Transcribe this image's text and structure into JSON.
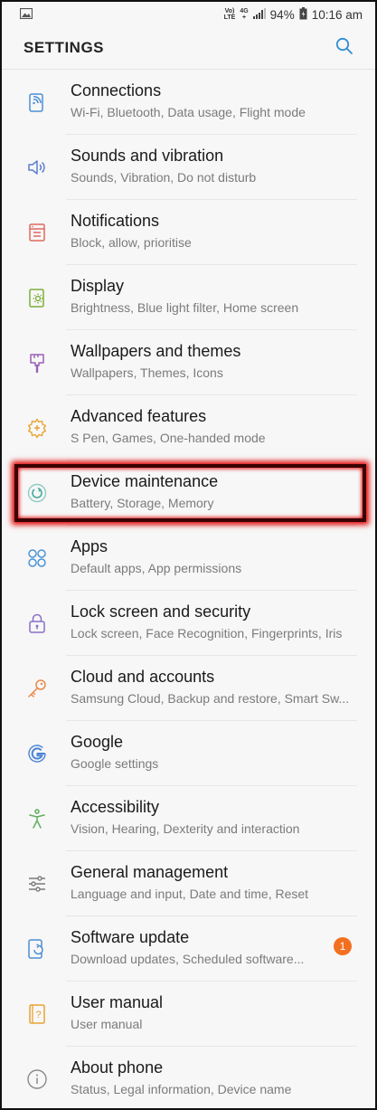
{
  "statusbar": {
    "net_top": "Vo)",
    "net_bottom": "LTE",
    "g_top": "4G",
    "g_bottom": "+",
    "battery": "94%",
    "time": "10:16 am"
  },
  "header": {
    "title": "SETTINGS"
  },
  "items": [
    {
      "title": "Connections",
      "sub": "Wi-Fi, Bluetooth, Data usage, Flight mode",
      "icon": "connections-icon",
      "color": "#4a8fd6"
    },
    {
      "title": "Sounds and vibration",
      "sub": "Sounds, Vibration, Do not disturb",
      "icon": "speaker-icon",
      "color": "#5b7fd1"
    },
    {
      "title": "Notifications",
      "sub": "Block, allow, prioritise",
      "icon": "notifications-icon",
      "color": "#e0695f"
    },
    {
      "title": "Display",
      "sub": "Brightness, Blue light filter, Home screen",
      "icon": "display-icon",
      "color": "#7fae3b"
    },
    {
      "title": "Wallpapers and themes",
      "sub": "Wallpapers, Themes, Icons",
      "icon": "brush-icon",
      "color": "#9a5fb5"
    },
    {
      "title": "Advanced features",
      "sub": "S Pen, Games, One-handed mode",
      "icon": "gear-plus-icon",
      "color": "#e8a332"
    },
    {
      "title": "Device maintenance",
      "sub": "Battery, Storage, Memory",
      "icon": "maintenance-icon",
      "color": "#3aa79b"
    },
    {
      "title": "Apps",
      "sub": "Default apps, App permissions",
      "icon": "apps-icon",
      "color": "#4a94d6"
    },
    {
      "title": "Lock screen and security",
      "sub": "Lock screen, Face Recognition, Fingerprints, Iris",
      "icon": "lock-icon",
      "color": "#8a6fc7"
    },
    {
      "title": "Cloud and accounts",
      "sub": "Samsung Cloud, Backup and restore, Smart Sw...",
      "icon": "key-icon",
      "color": "#e8894a"
    },
    {
      "title": "Google",
      "sub": "Google settings",
      "icon": "google-icon",
      "color": "#4a84d6"
    },
    {
      "title": "Accessibility",
      "sub": "Vision, Hearing, Dexterity and interaction",
      "icon": "accessibility-icon",
      "color": "#5fae5f"
    },
    {
      "title": "General management",
      "sub": "Language and input, Date and time, Reset",
      "icon": "sliders-icon",
      "color": "#7b7b7b"
    },
    {
      "title": "Software update",
      "sub": "Download updates, Scheduled software...",
      "icon": "update-icon",
      "color": "#4a8fd6",
      "badge": "1"
    },
    {
      "title": "User manual",
      "sub": "User manual",
      "icon": "manual-icon",
      "color": "#e8a332"
    },
    {
      "title": "About phone",
      "sub": "Status, Legal information, Device name",
      "icon": "info-icon",
      "color": "#8a8a8a"
    }
  ],
  "highlighted_item": "Device maintenance"
}
